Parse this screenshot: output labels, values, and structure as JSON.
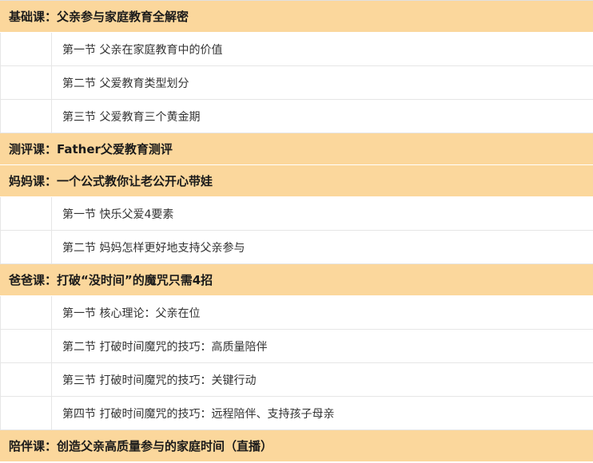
{
  "sections": [
    {
      "title": "基础课：父亲参与家庭教育全解密",
      "lessons": [
        "第一节 父亲在家庭教育中的价值",
        "第二节 父爱教育类型划分",
        "第三节 父爱教育三个黄金期"
      ]
    },
    {
      "title": "测评课：Father父爱教育测评",
      "lessons": []
    },
    {
      "title": "妈妈课：一个公式教你让老公开心带娃",
      "lessons": [
        "第一节 快乐父爱4要素",
        "第二节 妈妈怎样更好地支持父亲参与"
      ]
    },
    {
      "title": "爸爸课：打破“没时间”的魔咒只需4招",
      "lessons": [
        "第一节 核心理论：父亲在位",
        "第二节 打破时间魔咒的技巧：高质量陪伴",
        "第三节 打破时间魔咒的技巧：关键行动",
        "第四节 打破时间魔咒的技巧：远程陪伴、支持孩子母亲"
      ]
    },
    {
      "title": "陪伴课：创造父亲高质量参与的家庭时间（直播）",
      "lessons": []
    }
  ],
  "colors": {
    "section_background": "#fbd79c",
    "lesson_background": "#ffffff",
    "border": "#e6e6e6"
  }
}
